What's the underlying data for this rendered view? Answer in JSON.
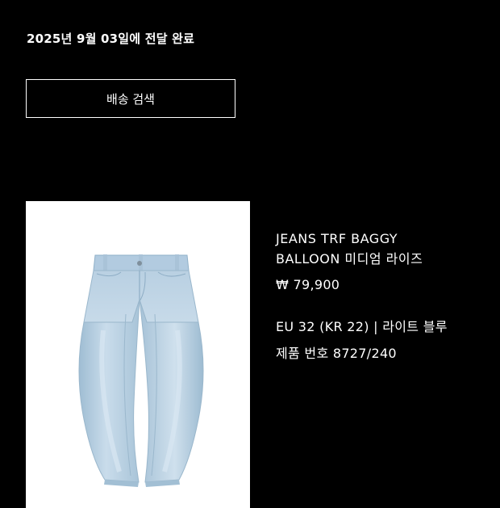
{
  "order": {
    "delivery_status": "2025년 9월 03일에 전달 완료",
    "track_button_label": "배송 검색"
  },
  "product": {
    "name_line1": "JEANS TRF BAGGY",
    "name_line2": "BALLOON 미디엄 라이즈",
    "price": "₩ 79,900",
    "variant": "EU 32 (KR 22) | 라이트 블루",
    "sku": "제품 번호 8727/240",
    "image_icon": "jeans-product-photo"
  },
  "colors": {
    "background": "#000000",
    "text": "#ffffff",
    "denim": "#b7cfe0"
  }
}
